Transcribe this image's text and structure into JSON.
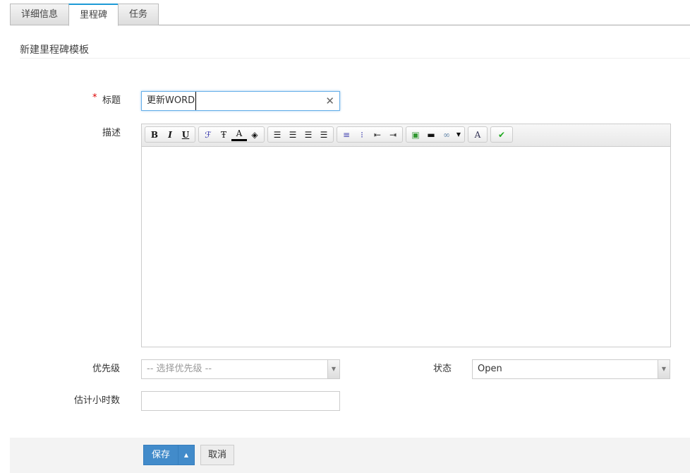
{
  "tabs": [
    {
      "label": "详细信息"
    },
    {
      "label": "里程碑"
    },
    {
      "label": "任务"
    }
  ],
  "section_title": "新建里程碑模板",
  "form": {
    "title_label": "标题",
    "required_mark": "*",
    "title_value": "更新WORD",
    "description_label": "描述",
    "priority_label": "优先级",
    "priority_placeholder": "-- 选择优先级 --",
    "status_label": "状态",
    "status_value": "Open",
    "hours_label": "估计小时数",
    "hours_value": ""
  },
  "toolbar": {
    "bold": "B",
    "italic": "I",
    "underline": "U"
  },
  "buttons": {
    "save": "保存",
    "cancel": "取消"
  }
}
